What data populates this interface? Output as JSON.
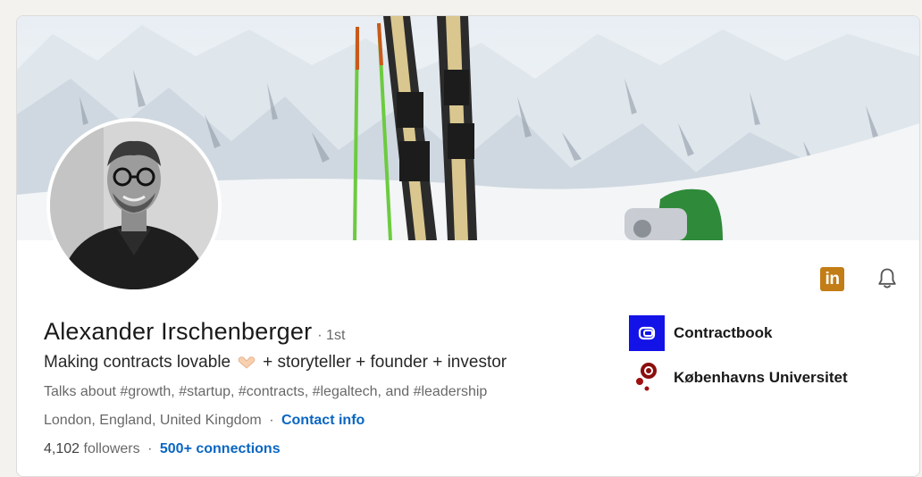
{
  "profile": {
    "name": "Alexander Irschenberger",
    "degree": "· 1st",
    "headline_pre": "Making contracts lovable",
    "headline_post": "+ storyteller + founder + investor",
    "talks_about": "Talks about #growth, #startup, #contracts, #legaltech, and #leadership",
    "location": "London, England, United Kingdom",
    "contact_info": "Contact info",
    "followers_count": "4,102",
    "followers_label": "followers",
    "connections": "500+ connections"
  },
  "actions": {
    "linkedin_badge": "in"
  },
  "side": {
    "items": [
      {
        "label": "Contractbook",
        "icon": "contractbook-logo"
      },
      {
        "label": "Københavns Universitet",
        "icon": "university-seal-logo"
      }
    ]
  },
  "colors": {
    "link": "#0a66c2",
    "contractbook": "#1313e8",
    "li_badge": "#c37d16"
  }
}
